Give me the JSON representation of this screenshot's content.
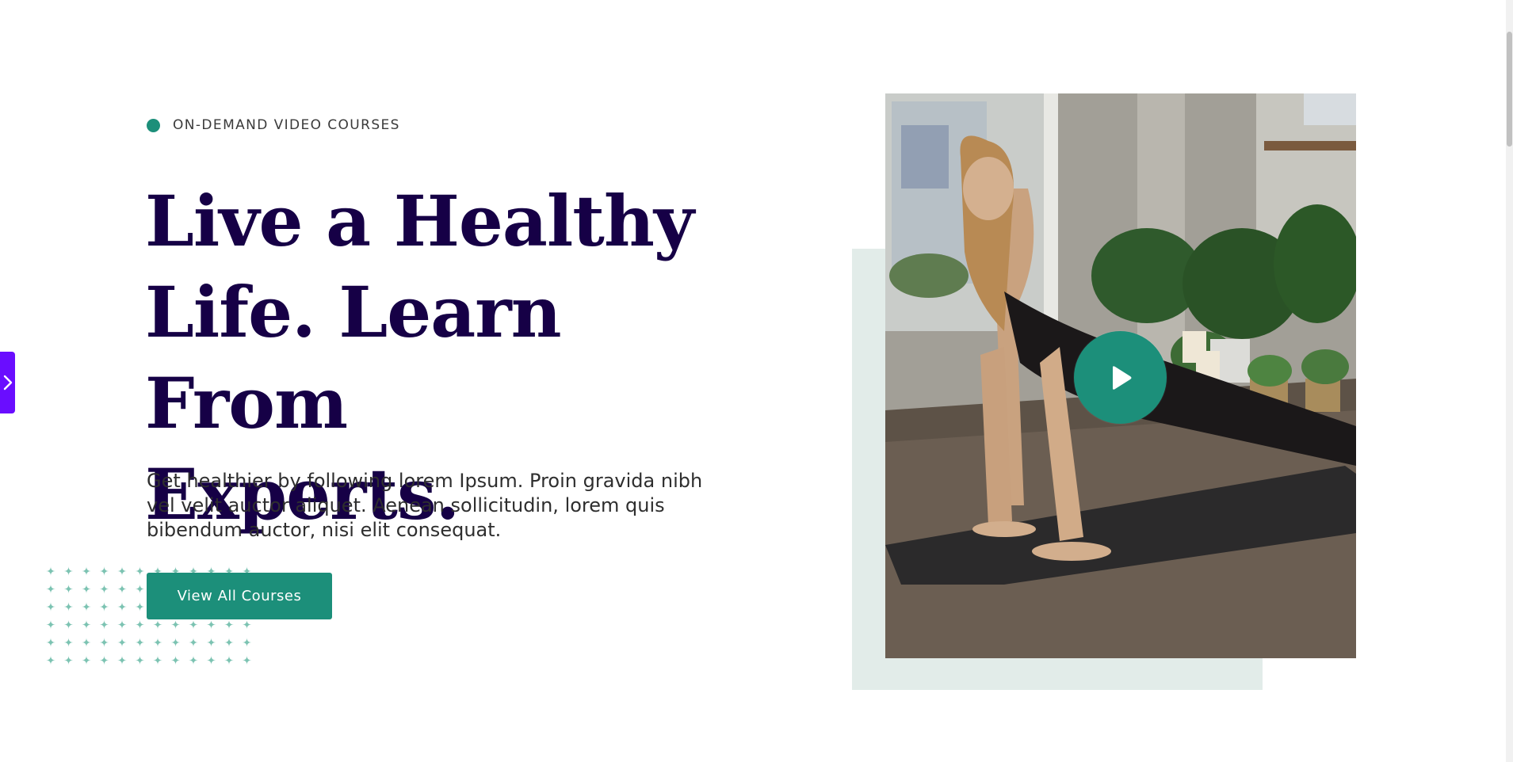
{
  "hero": {
    "eyebrow": "ON-DEMAND VIDEO COURSES",
    "headline_lines": [
      "Live a Healthy",
      "Life. Learn From",
      "Experts."
    ],
    "subtitle_lines": [
      "Get healthier by following lorem Ipsum. Proin gravida nibh",
      "vel velit auctor aliquet. Aenean sollicitudin, lorem quis",
      "bibendum auctor, nisi elit consequat."
    ],
    "cta_label": "View All Courses"
  },
  "media": {
    "image_subject": "woman-yoga-downward-dog",
    "play_icon": "play-icon"
  },
  "side_tab": {
    "icon": "chevron-right-icon"
  },
  "colors": {
    "accent": "#1c8f7a",
    "headline": "#160046",
    "side_tab": "#6a0dff",
    "media_backdrop": "#e2ece9",
    "dot_pattern": "#7cc3b2"
  }
}
